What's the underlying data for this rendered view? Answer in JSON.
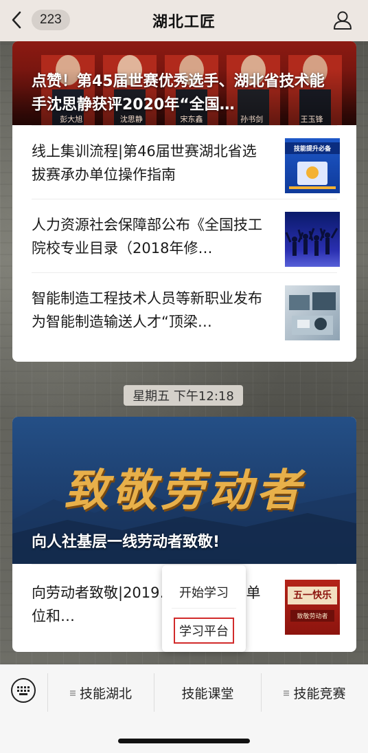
{
  "navbar": {
    "badge_count": "223",
    "title": "湖北工匠"
  },
  "card1": {
    "hero_title": "点赞！第45届世赛优秀选手、湖北省技术能手沈思静获评2020年“全国…",
    "hero_names": [
      "彭大旭",
      "沈思静",
      "宋东鑫",
      "孙书剑",
      "王玉锋"
    ],
    "articles": [
      {
        "title": "线上集训流程|第46届世赛湖北省选拔赛承办单位操作指南",
        "thumb_text": "技能提升必备"
      },
      {
        "title": "人力资源社会保障部公布《全国技工院校专业目录（2018年修…"
      },
      {
        "title": "智能制造工程技术人员等新职业发布为智能制造输送人才“顶梁…"
      }
    ]
  },
  "time_label": "星期五 下午12:18",
  "card2": {
    "banner_text": "致敬劳动者",
    "hero_title": "向人社基层一线劳动者致敬!",
    "articles": [
      {
        "title": "向劳动者致敬|2019…动竞赛先进单位和…",
        "thumb_text_main": "五一快乐",
        "thumb_text_sub": "致敬劳动者"
      }
    ]
  },
  "popup": {
    "items": [
      "开始学习",
      "学习平台"
    ]
  },
  "bottom_menu": {
    "items": [
      "技能湖北",
      "技能课堂",
      "技能竞赛"
    ]
  },
  "colors": {
    "accent_red": "#d12a2a",
    "navbar_bg": "#ede7e2"
  }
}
